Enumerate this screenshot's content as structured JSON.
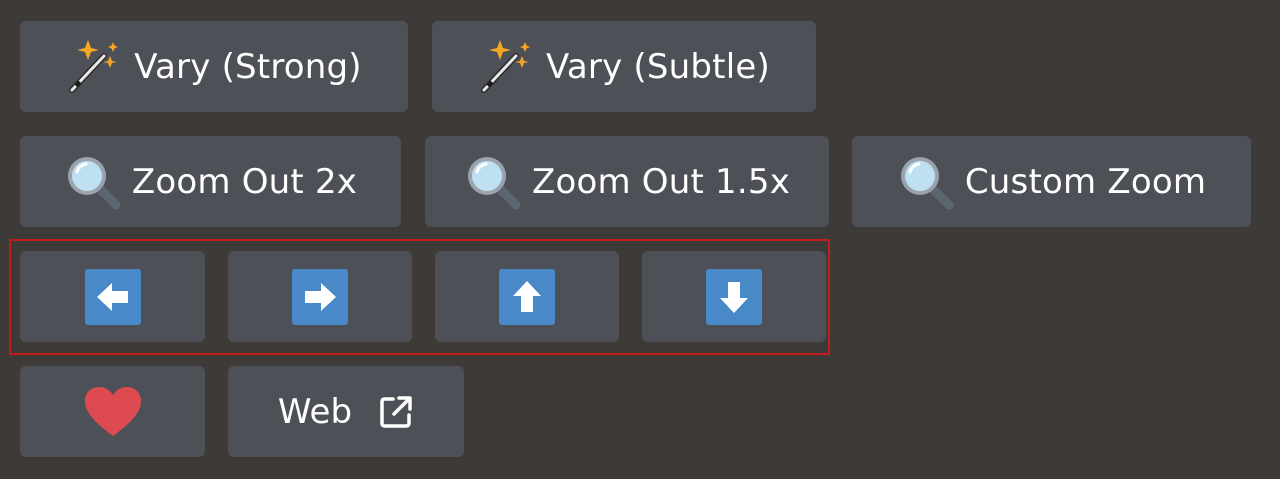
{
  "rows": {
    "vary": [
      {
        "label": "Vary (Strong)",
        "icon": "magic-wand-icon"
      },
      {
        "label": "Vary (Subtle)",
        "icon": "magic-wand-icon"
      }
    ],
    "zoom": [
      {
        "label": "Zoom Out 2x",
        "icon": "magnifier-icon"
      },
      {
        "label": "Zoom Out 1.5x",
        "icon": "magnifier-icon"
      },
      {
        "label": "Custom Zoom",
        "icon": "magnifier-icon"
      }
    ],
    "pan": [
      {
        "icon": "arrow-left-icon"
      },
      {
        "icon": "arrow-right-icon"
      },
      {
        "icon": "arrow-up-icon"
      },
      {
        "icon": "arrow-down-icon"
      }
    ],
    "extra": {
      "favorite_icon": "heart-icon",
      "web_label": "Web",
      "web_icon": "external-link-icon"
    }
  },
  "colors": {
    "background": "#3e3a37",
    "button": "#4e5058",
    "arrow": "#4a89c7",
    "heart": "#dd4a4f",
    "highlight": "#c21d1d"
  }
}
